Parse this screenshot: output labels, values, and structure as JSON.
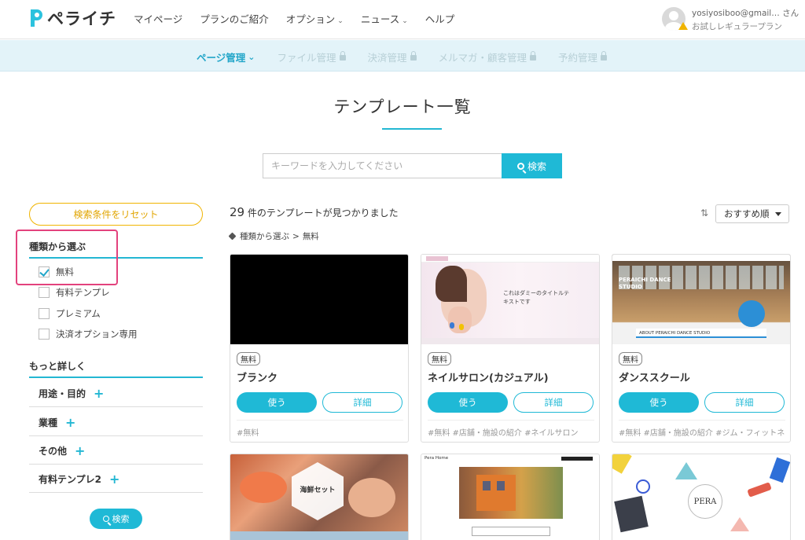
{
  "header": {
    "logo_text": "ペライチ",
    "nav": [
      {
        "label": "マイページ",
        "dropdown": false
      },
      {
        "label": "プランのご紹介",
        "dropdown": false
      },
      {
        "label": "オプション",
        "dropdown": true
      },
      {
        "label": "ニュース",
        "dropdown": true
      },
      {
        "label": "ヘルプ",
        "dropdown": false
      }
    ],
    "user": {
      "name": "yosiyosiboo@gmail… さん",
      "plan": "お試しレギュラープラン"
    }
  },
  "subnav": {
    "items": [
      {
        "label": "ページ管理",
        "active": true
      },
      {
        "label": "ファイル管理",
        "active": false
      },
      {
        "label": "決済管理",
        "active": false
      },
      {
        "label": "メルマガ・顧客管理",
        "active": false
      },
      {
        "label": "予約管理",
        "active": false
      }
    ]
  },
  "page": {
    "title": "テンプレート一覧"
  },
  "search": {
    "placeholder": "キーワードを入力してください",
    "button": "検索"
  },
  "sidebar": {
    "reset_label": "検索条件をリセット",
    "type_title": "種類から選ぶ",
    "types": [
      {
        "label": "無料",
        "checked": true
      },
      {
        "label": "有料テンプレ",
        "checked": false
      },
      {
        "label": "プレミアム",
        "checked": false
      },
      {
        "label": "決済オプション専用",
        "checked": false
      }
    ],
    "detail_title": "もっと詳しく",
    "filters": [
      "用途・目的",
      "業種",
      "その他",
      "有料テンプレ2"
    ],
    "search_label": "検索"
  },
  "results": {
    "count": "29",
    "count_suffix": "件のテンプレートが見つかりました",
    "breadcrumb_root": "種類から選ぶ",
    "breadcrumb_sep": ">",
    "breadcrumb_current": "無料",
    "sort_label": "おすすめ順"
  },
  "cards": [
    {
      "badge": "無料",
      "title": "ブランク",
      "use": "使う",
      "detail": "詳細",
      "tags": "#無料"
    },
    {
      "badge": "無料",
      "title": "ネイルサロン(カジュアル)",
      "use": "使う",
      "detail": "詳細",
      "tags": "#無料 #店舗・施設の紹介 #ネイルサロン",
      "thumb_heading": "これはダミーのタイトルテキストです"
    },
    {
      "badge": "無料",
      "title": "ダンススクール",
      "use": "使う",
      "detail": "詳細",
      "tags": "#無料 #店舗・施設の紹介 #ジム・フィットネス",
      "thumb_heading": "PERAICHI DANCE STUDIO",
      "thumb_bar": "ABOUT PERAICHI DANCE STUDIO"
    }
  ],
  "thumbs2": {
    "seafood_heading": "海鮮セット",
    "pera": "PERA",
    "pera_home": "Pera Home"
  },
  "colors": {
    "accent": "#1fb9d6",
    "reset": "#f0b400",
    "highlight": "#e3427d"
  }
}
